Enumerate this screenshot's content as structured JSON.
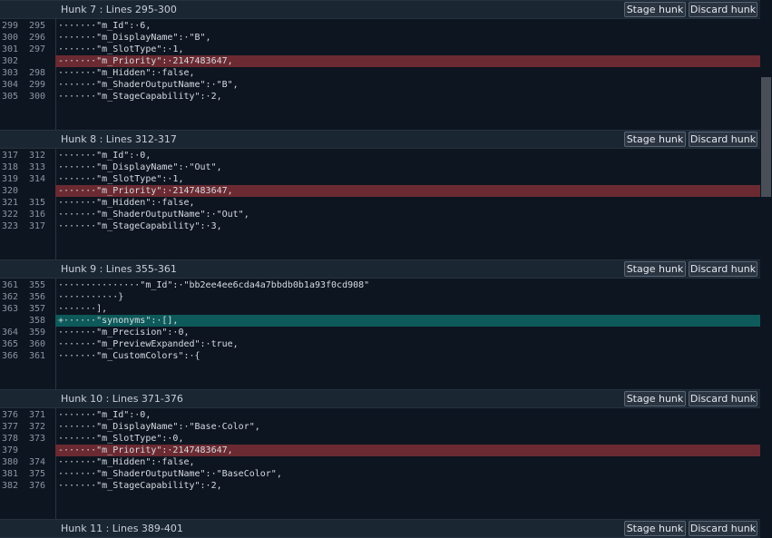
{
  "buttons": {
    "stage": "Stage hunk",
    "discard": "Discard hunk"
  },
  "hunks": [
    {
      "title": "Hunk 7 : Lines 295-300",
      "lines": [
        {
          "old": "299",
          "new": "295",
          "type": "ctx",
          "text": "·······\"m_Id\":·6,"
        },
        {
          "old": "300",
          "new": "296",
          "type": "ctx",
          "text": "·······\"m_DisplayName\":·\"B\","
        },
        {
          "old": "301",
          "new": "297",
          "type": "ctx",
          "text": "·······\"m_SlotType\":·1,"
        },
        {
          "old": "302",
          "new": "",
          "type": "removed",
          "text": "-······\"m_Priority\":·2147483647,"
        },
        {
          "old": "303",
          "new": "298",
          "type": "ctx",
          "text": "·······\"m_Hidden\":·false,"
        },
        {
          "old": "304",
          "new": "299",
          "type": "ctx",
          "text": "·······\"m_ShaderOutputName\":·\"B\","
        },
        {
          "old": "305",
          "new": "300",
          "type": "ctx",
          "text": "·······\"m_StageCapability\":·2,"
        }
      ]
    },
    {
      "title": "Hunk 8 : Lines 312-317",
      "lines": [
        {
          "old": "317",
          "new": "312",
          "type": "ctx",
          "text": "·······\"m_Id\":·0,"
        },
        {
          "old": "318",
          "new": "313",
          "type": "ctx",
          "text": "·······\"m_DisplayName\":·\"Out\","
        },
        {
          "old": "319",
          "new": "314",
          "type": "ctx",
          "text": "·······\"m_SlotType\":·1,"
        },
        {
          "old": "320",
          "new": "",
          "type": "removed",
          "text": "-······\"m_Priority\":·2147483647,"
        },
        {
          "old": "321",
          "new": "315",
          "type": "ctx",
          "text": "·······\"m_Hidden\":·false,"
        },
        {
          "old": "322",
          "new": "316",
          "type": "ctx",
          "text": "·······\"m_ShaderOutputName\":·\"Out\","
        },
        {
          "old": "323",
          "new": "317",
          "type": "ctx",
          "text": "·······\"m_StageCapability\":·3,"
        }
      ]
    },
    {
      "title": "Hunk 9 : Lines 355-361",
      "lines": [
        {
          "old": "361",
          "new": "355",
          "type": "ctx",
          "text": "···············\"m_Id\":·\"bb2ee4ee6cda4a7bbdb0b1a93f0cd908\""
        },
        {
          "old": "362",
          "new": "356",
          "type": "ctx",
          "text": "···········}"
        },
        {
          "old": "363",
          "new": "357",
          "type": "ctx",
          "text": "·······],"
        },
        {
          "old": "",
          "new": "358",
          "type": "added",
          "text": "+······\"synonyms\":·[],"
        },
        {
          "old": "364",
          "new": "359",
          "type": "ctx",
          "text": "·······\"m_Precision\":·0,"
        },
        {
          "old": "365",
          "new": "360",
          "type": "ctx",
          "text": "·······\"m_PreviewExpanded\":·true,"
        },
        {
          "old": "366",
          "new": "361",
          "type": "ctx",
          "text": "·······\"m_CustomColors\":·{"
        }
      ]
    },
    {
      "title": "Hunk 10 : Lines 371-376",
      "lines": [
        {
          "old": "376",
          "new": "371",
          "type": "ctx",
          "text": "·······\"m_Id\":·0,"
        },
        {
          "old": "377",
          "new": "372",
          "type": "ctx",
          "text": "·······\"m_DisplayName\":·\"Base·Color\","
        },
        {
          "old": "378",
          "new": "373",
          "type": "ctx",
          "text": "·······\"m_SlotType\":·0,"
        },
        {
          "old": "379",
          "new": "",
          "type": "removed",
          "text": "-······\"m_Priority\":·2147483647,"
        },
        {
          "old": "380",
          "new": "374",
          "type": "ctx",
          "text": "·······\"m_Hidden\":·false,"
        },
        {
          "old": "381",
          "new": "375",
          "type": "ctx",
          "text": "·······\"m_ShaderOutputName\":·\"BaseColor\","
        },
        {
          "old": "382",
          "new": "376",
          "type": "ctx",
          "text": "·······\"m_StageCapability\":·2,"
        }
      ]
    },
    {
      "title": "Hunk 11 : Lines 389-401",
      "lines": []
    }
  ]
}
